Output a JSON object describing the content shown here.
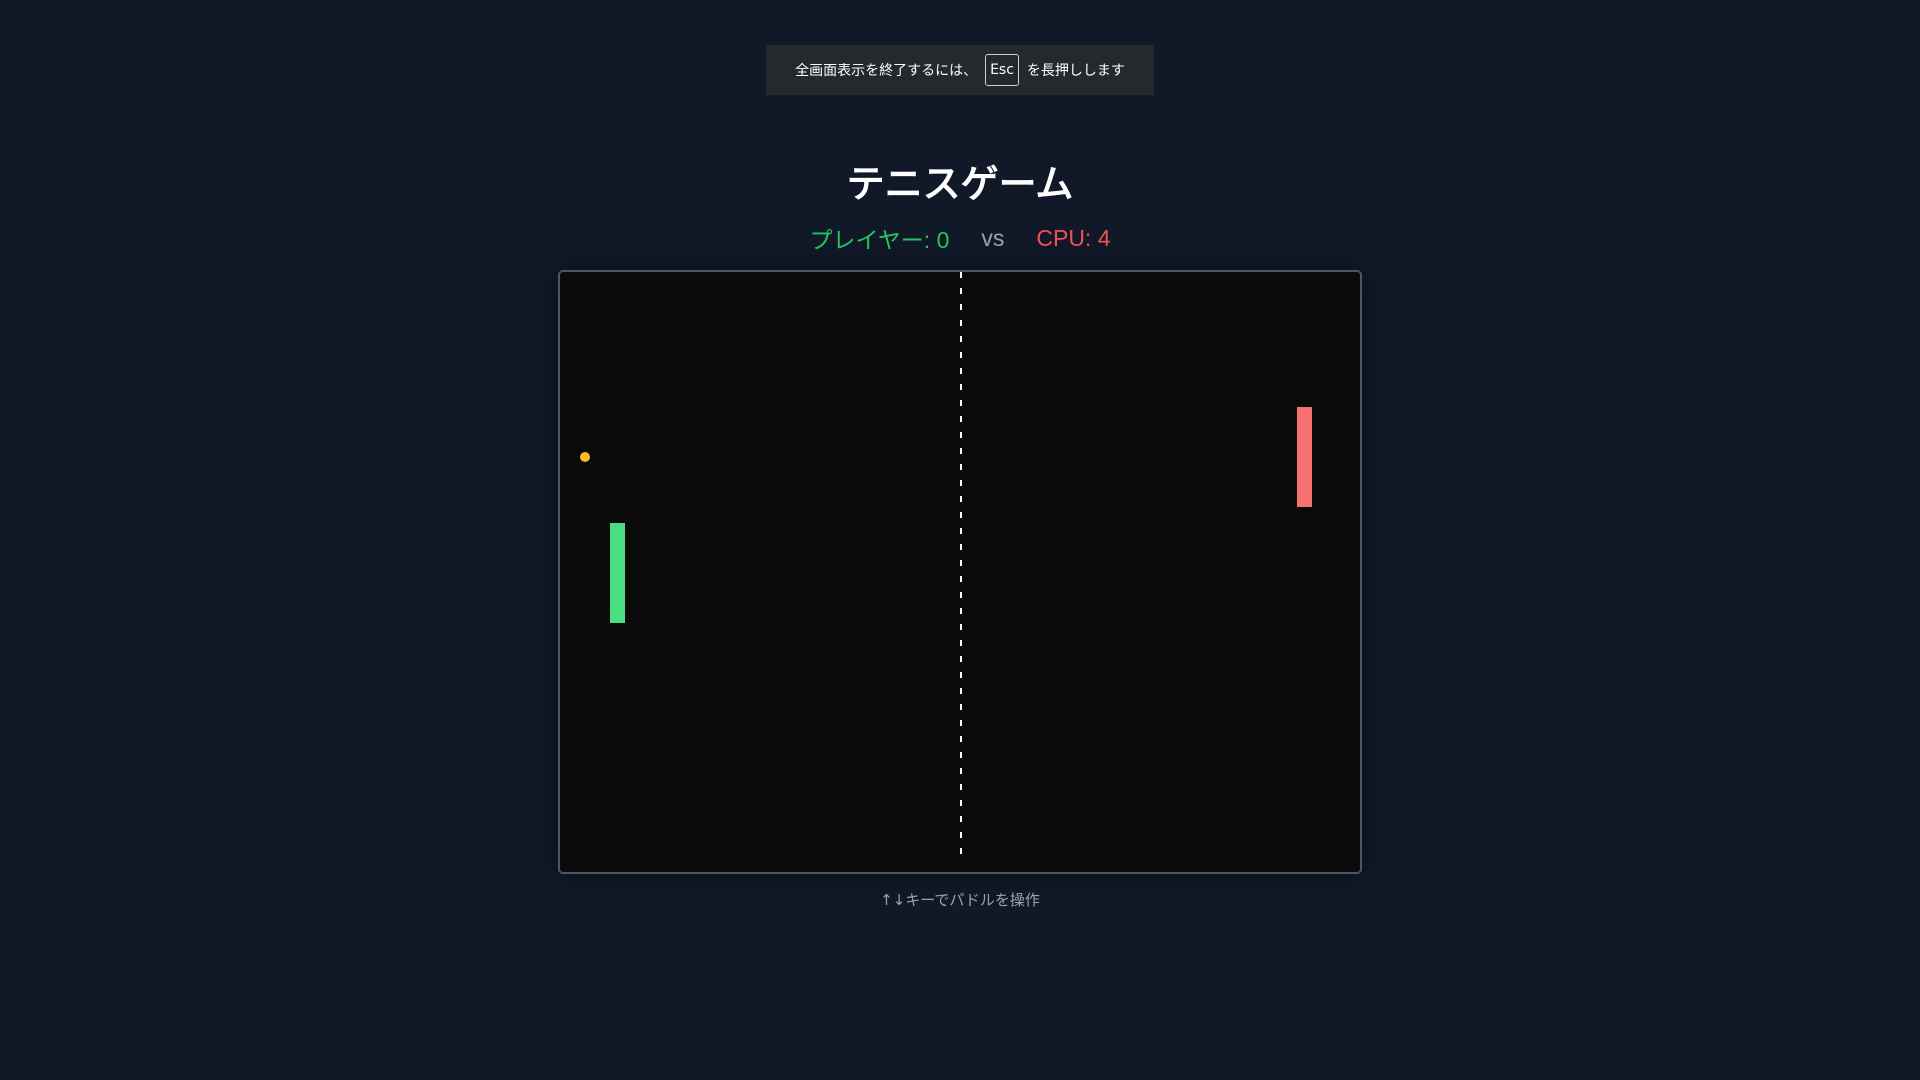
{
  "fullscreen_notice": {
    "before": "全画面表示を終了するには、",
    "key": "Esc",
    "after": "を長押しします"
  },
  "game": {
    "title": "テニスゲーム",
    "score": {
      "player_text": "プレイヤー: 0",
      "player_value": 0,
      "vs": "vs",
      "cpu_text": "CPU: 4",
      "cpu_value": 4
    },
    "hint": "↑↓キーでパドルを操作"
  },
  "colors": {
    "background": "#111827",
    "court": "#0a0a0a",
    "player": "#4ade80",
    "cpu": "#f87171",
    "ball": "#fbbf24",
    "net": "#ffffff"
  }
}
